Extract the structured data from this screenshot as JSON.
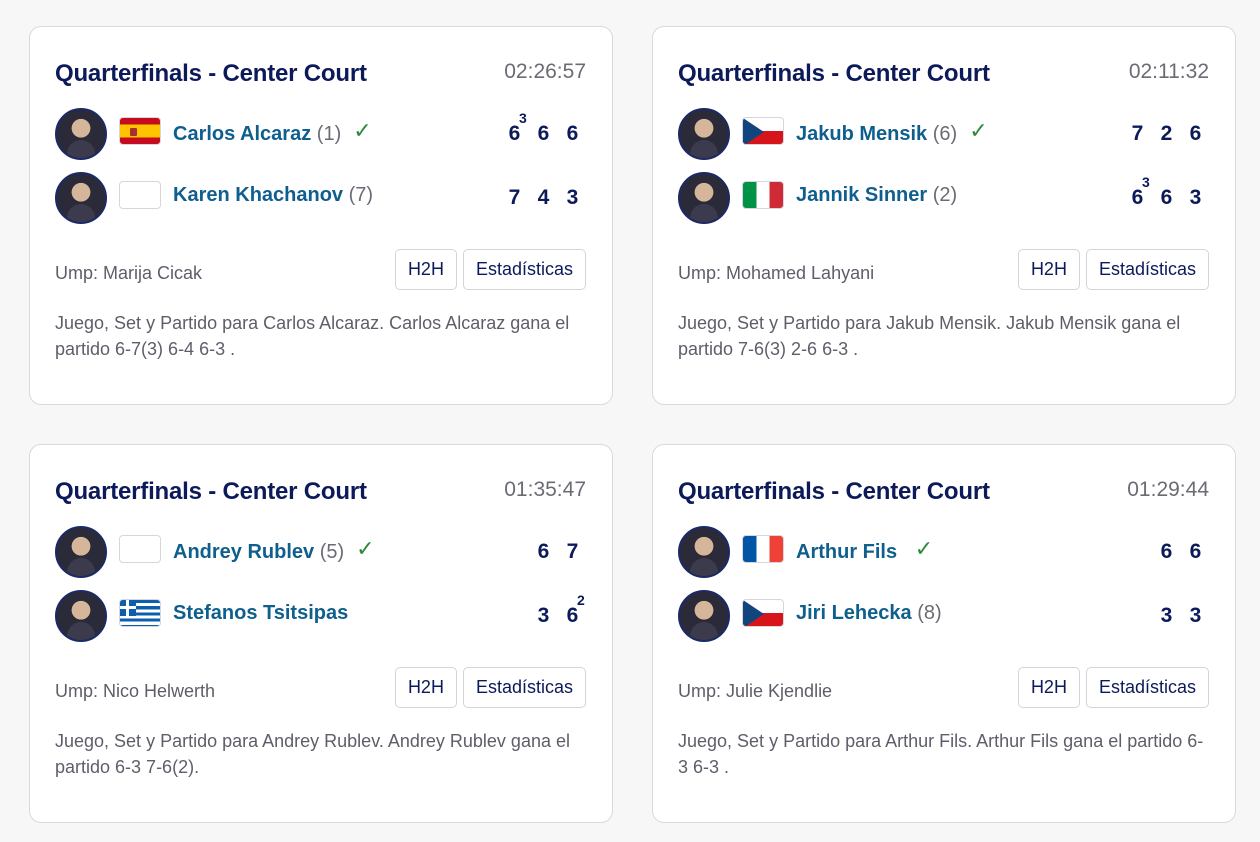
{
  "matches": [
    {
      "title": "Quarterfinals - Center Court",
      "duration": "02:26:57",
      "players": [
        {
          "name": "Carlos Alcaraz",
          "seed": "(1)",
          "flag": "es",
          "winner": true,
          "scores": [
            {
              "v": "6",
              "tb": "3"
            },
            {
              "v": "6",
              "tb": ""
            },
            {
              "v": "6",
              "tb": ""
            }
          ]
        },
        {
          "name": "Karen Khachanov",
          "seed": "(7)",
          "flag": "blank",
          "winner": false,
          "scores": [
            {
              "v": "7",
              "tb": ""
            },
            {
              "v": "4",
              "tb": ""
            },
            {
              "v": "3",
              "tb": ""
            }
          ]
        }
      ],
      "umpire": "Ump: Marija Cicak",
      "h2h_label": "H2H",
      "stats_label": "Estadísticas",
      "summary": "Juego, Set y Partido para Carlos Alcaraz. Carlos Alcaraz gana el partido 6-7(3) 6-4 6-3 ."
    },
    {
      "title": "Quarterfinals - Center Court",
      "duration": "02:11:32",
      "players": [
        {
          "name": "Jakub Mensik",
          "seed": "(6)",
          "flag": "cz",
          "winner": true,
          "scores": [
            {
              "v": "7",
              "tb": ""
            },
            {
              "v": "2",
              "tb": ""
            },
            {
              "v": "6",
              "tb": ""
            }
          ]
        },
        {
          "name": "Jannik Sinner",
          "seed": "(2)",
          "flag": "it",
          "winner": false,
          "scores": [
            {
              "v": "6",
              "tb": "3"
            },
            {
              "v": "6",
              "tb": ""
            },
            {
              "v": "3",
              "tb": ""
            }
          ]
        }
      ],
      "umpire": "Ump: Mohamed Lahyani",
      "h2h_label": "H2H",
      "stats_label": "Estadísticas",
      "summary": "Juego, Set y Partido para Jakub Mensik. Jakub Mensik gana el partido 7-6(3) 2-6 6-3 ."
    },
    {
      "title": "Quarterfinals - Center Court",
      "duration": "01:35:47",
      "players": [
        {
          "name": "Andrey Rublev",
          "seed": "(5)",
          "flag": "blank",
          "winner": true,
          "scores": [
            {
              "v": "6",
              "tb": ""
            },
            {
              "v": "7",
              "tb": ""
            }
          ]
        },
        {
          "name": "Stefanos Tsitsipas",
          "seed": "",
          "flag": "gr",
          "winner": false,
          "scores": [
            {
              "v": "3",
              "tb": ""
            },
            {
              "v": "6",
              "tb": "2"
            }
          ]
        }
      ],
      "umpire": "Ump: Nico Helwerth",
      "h2h_label": "H2H",
      "stats_label": "Estadísticas",
      "summary": "Juego, Set y Partido para Andrey Rublev. Andrey Rublev gana el partido 6-3 7-6(2)."
    },
    {
      "title": "Quarterfinals - Center Court",
      "duration": "01:29:44",
      "players": [
        {
          "name": "Arthur Fils",
          "seed": "",
          "flag": "fr",
          "winner": true,
          "scores": [
            {
              "v": "6",
              "tb": ""
            },
            {
              "v": "6",
              "tb": ""
            }
          ]
        },
        {
          "name": "Jiri Lehecka",
          "seed": "(8)",
          "flag": "cz",
          "winner": false,
          "scores": [
            {
              "v": "3",
              "tb": ""
            },
            {
              "v": "3",
              "tb": ""
            }
          ]
        }
      ],
      "umpire": "Ump: Julie Kjendlie",
      "h2h_label": "H2H",
      "stats_label": "Estadísticas",
      "summary": "Juego, Set y Partido para Arthur Fils. Arthur Fils gana el partido 6-3 6-3 ."
    }
  ]
}
